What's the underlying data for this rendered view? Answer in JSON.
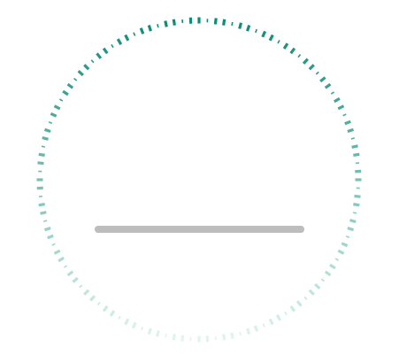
{
  "spinner": {
    "icon": "loading-ring-icon",
    "accent_color": "#0f8a78",
    "fade_color": "#dff5f0"
  },
  "progress": {
    "value": 1.0,
    "track_color": "#bdbdbd",
    "fill_color": "#bdbdbd"
  }
}
